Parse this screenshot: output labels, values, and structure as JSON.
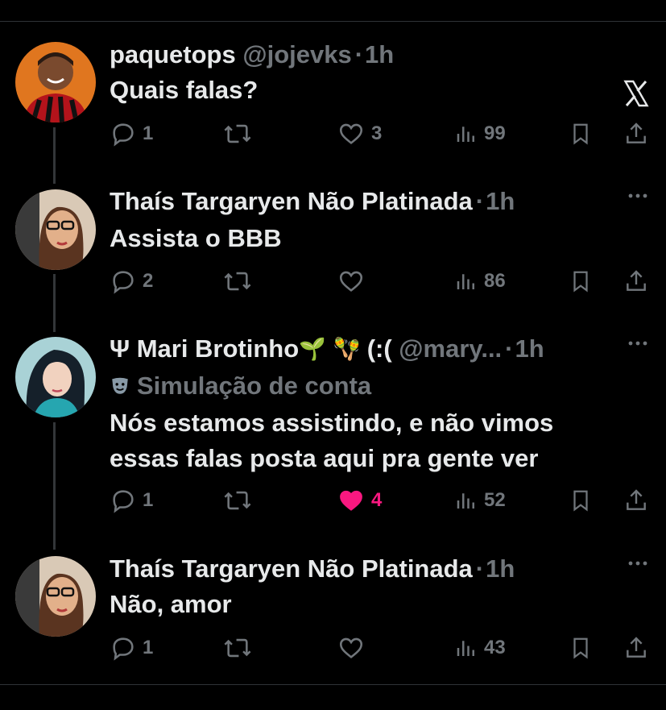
{
  "colors": {
    "background": "#000000",
    "text": "#e7e9ea",
    "muted": "#71767b",
    "divider": "#2f3336",
    "like_active": "#f91880"
  },
  "tweets": [
    {
      "name": "paquetops",
      "handle": "@jojevks",
      "time": "1h",
      "text": "Quais falas?",
      "replies": "1",
      "retweets": "",
      "likes": "3",
      "views": "99",
      "liked": false,
      "corner_icon": "x-logo-icon"
    },
    {
      "name": "Thaís Targaryen Não Platinada",
      "handle": "",
      "time": "1h",
      "text": "Assista o BBB",
      "replies": "2",
      "retweets": "",
      "likes": "",
      "views": "86",
      "liked": false,
      "corner_icon": "more-icon"
    },
    {
      "name": "Ψ Mari Brotinho",
      "name_suffix": "(:(",
      "handle": "@mary...",
      "time": "1h",
      "badge_text": "Simulação de conta",
      "text_lines": [
        "Nós estamos assistindo, e não vimos",
        "essas falas posta aqui pra gente ver"
      ],
      "replies": "1",
      "retweets": "",
      "likes": "4",
      "views": "52",
      "liked": true,
      "corner_icon": "more-icon"
    },
    {
      "name": "Thaís Targaryen Não Platinada",
      "handle": "",
      "time": "1h",
      "text": "Não, amor",
      "replies": "1",
      "retweets": "",
      "likes": "",
      "views": "43",
      "liked": false,
      "corner_icon": "more-icon"
    }
  ]
}
